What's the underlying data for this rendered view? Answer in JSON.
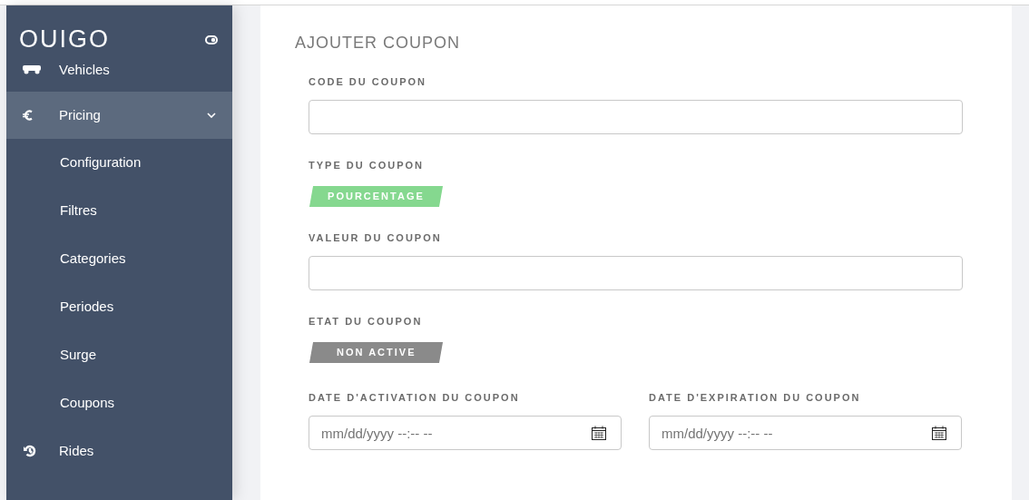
{
  "sidebar": {
    "brand": "OUIGO",
    "items": [
      {
        "label": "Vehicles",
        "expanded": false
      },
      {
        "label": "Pricing",
        "expanded": true,
        "children": [
          {
            "label": "Configuration"
          },
          {
            "label": "Filtres"
          },
          {
            "label": "Categories"
          },
          {
            "label": "Periodes"
          },
          {
            "label": "Surge"
          },
          {
            "label": "Coupons"
          }
        ]
      },
      {
        "label": "Rides",
        "expanded": false
      }
    ]
  },
  "form": {
    "title": "AJOUTER COUPON",
    "fields": [
      {
        "kind": "input",
        "label": "CODE DU COUPON"
      },
      {
        "kind": "badge",
        "label": "TYPE DU COUPON",
        "badge": "POURCENTAGE",
        "active": true
      },
      {
        "kind": "input",
        "label": "VALEUR DU COUPON"
      },
      {
        "kind": "badge",
        "label": "ETAT DU COUPON",
        "badge": "NON ACTIVE",
        "active": false
      }
    ],
    "dates": [
      {
        "label": "DATE D'ACTIVATION DU COUPON",
        "placeholder": "mm/dd/yyyy --:-- --"
      },
      {
        "label": "DATE D'EXPIRATION DU COUPON",
        "placeholder": "mm/dd/yyyy --:-- --"
      }
    ]
  }
}
